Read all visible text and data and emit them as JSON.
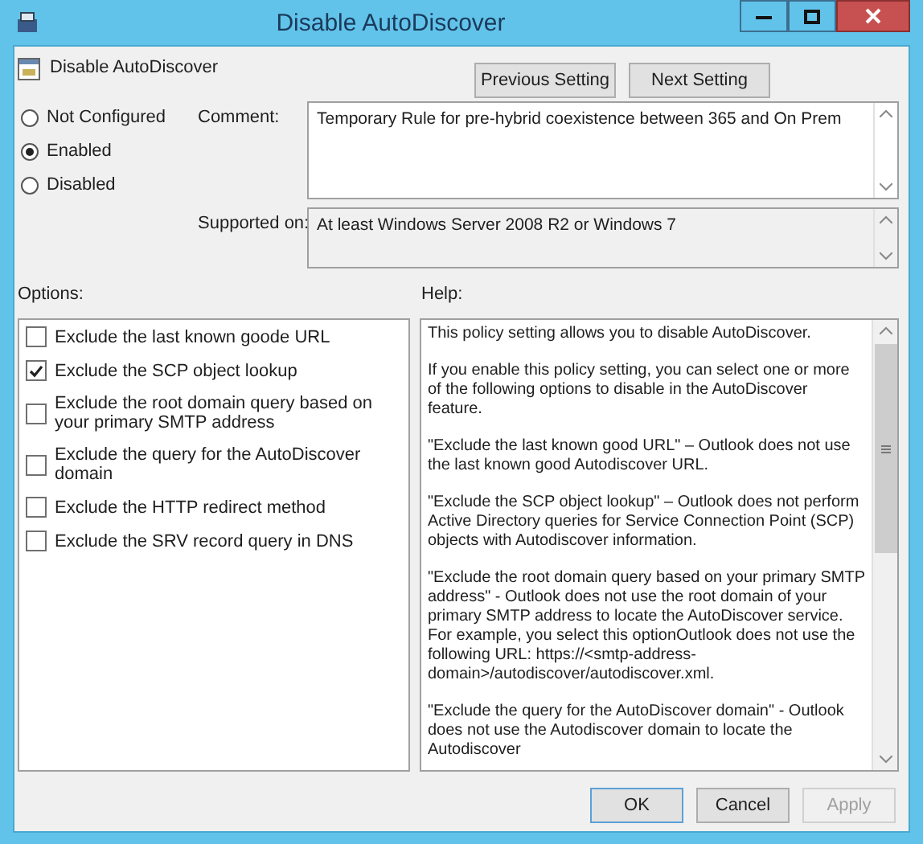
{
  "window": {
    "title": "Disable AutoDiscover"
  },
  "policy": {
    "title": "Disable AutoDiscover"
  },
  "nav_buttons": [
    "Previous Setting",
    "Next Setting"
  ],
  "states": [
    {
      "label": "Not Configured",
      "selected": false
    },
    {
      "label": "Enabled",
      "selected": true
    },
    {
      "label": "Disabled",
      "selected": false
    }
  ],
  "comment": {
    "label": "Comment:",
    "value": "Temporary Rule for pre-hybrid coexistence between 365 and On Prem"
  },
  "supported": {
    "label": "Supported on:",
    "value": "At least Windows Server 2008 R2 or Windows 7"
  },
  "options_label": "Options:",
  "help_label": "Help:",
  "options": [
    {
      "label": "Exclude the last known goode URL",
      "checked": false
    },
    {
      "label": "Exclude the SCP object lookup",
      "checked": true
    },
    {
      "label": "Exclude the root domain query based on your primary SMTP address",
      "checked": false
    },
    {
      "label": "Exclude the query for the AutoDiscover domain",
      "checked": false
    },
    {
      "label": "Exclude the HTTP redirect method",
      "checked": false
    },
    {
      "label": "Exclude the SRV record query in DNS",
      "checked": false
    }
  ],
  "help": [
    "This policy setting allows you to disable AutoDiscover.",
    "If you enable this policy setting, you can select one or more of the following options to disable in the AutoDiscover feature.",
    "\"Exclude the last known good URL\" – Outlook does not use the last known good Autodiscover URL.",
    "\"Exclude the SCP object lookup\" – Outlook does not perform Active Directory queries for Service Connection Point (SCP) objects with Autodiscover information.",
    "\"Exclude the root domain query based on your primary SMTP address\" - Outlook does not use the root domain of your primary SMTP address to locate the AutoDiscover service. For example, you select this optionOutlook does not use the following URL: https://<smtp-address-domain>/autodiscover/autodiscover.xml.",
    "\"Exclude the query for the AutoDiscover domain\" - Outlook does not use the Autodiscover domain to locate the Autodiscover"
  ],
  "buttons": [
    {
      "label": "OK",
      "disabled": false
    },
    {
      "label": "Cancel",
      "disabled": false
    },
    {
      "label": "Apply",
      "disabled": true
    }
  ]
}
